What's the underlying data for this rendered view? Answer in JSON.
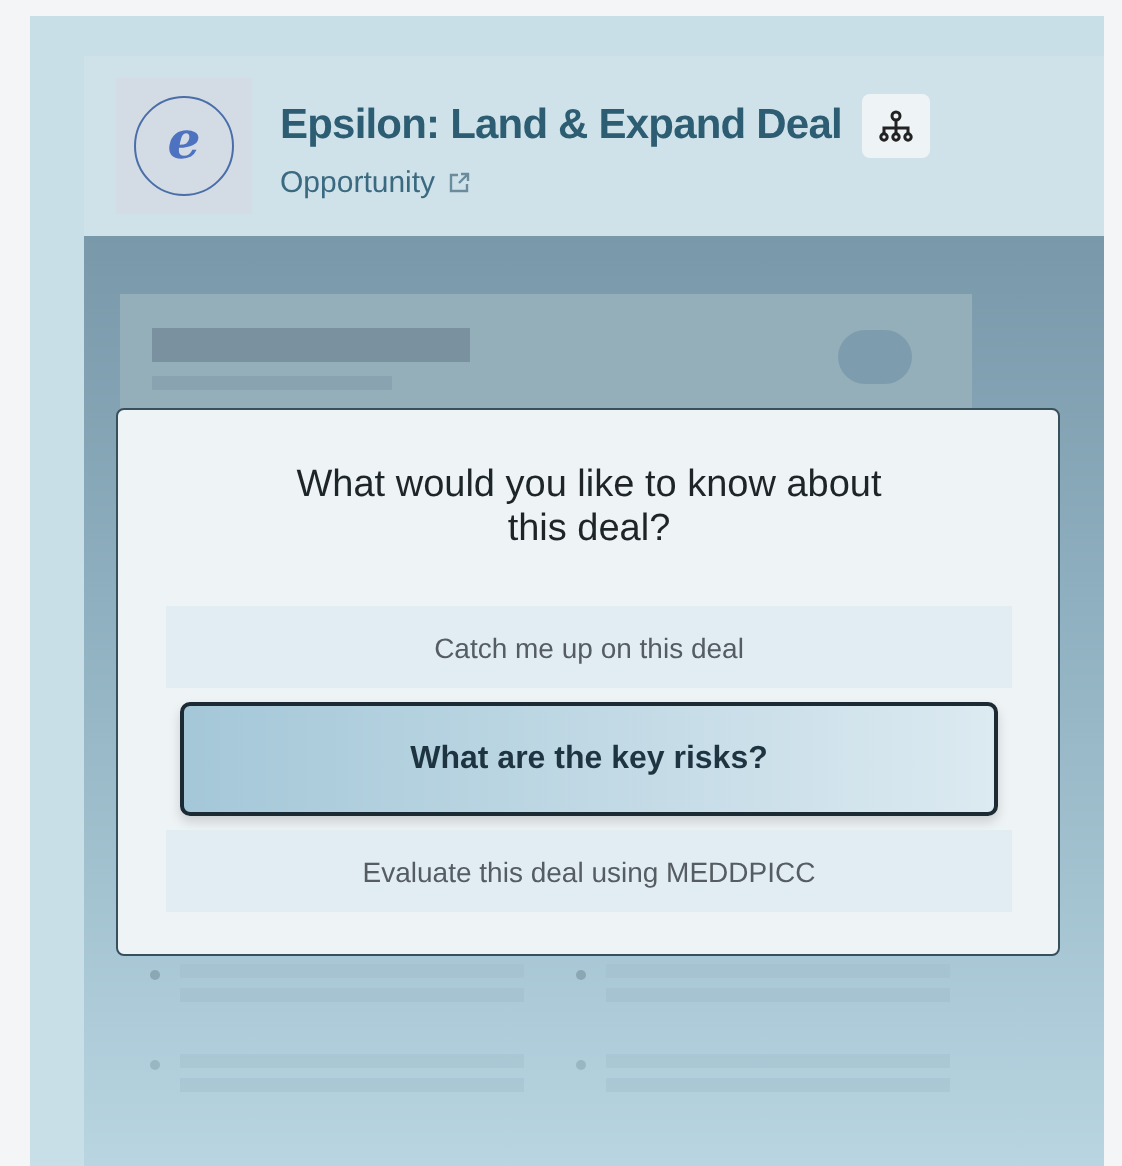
{
  "header": {
    "avatar_letter": "e",
    "title": "Epsilon: Land & Expand Deal",
    "subtitle": "Opportunity"
  },
  "dialog": {
    "question": "What would you like to know about this deal?",
    "options": [
      {
        "label": "Catch me up on this deal",
        "selected": false
      },
      {
        "label": "What are the key risks?",
        "selected": true
      },
      {
        "label": "Evaluate this deal using MEDDPICC",
        "selected": false
      }
    ]
  }
}
